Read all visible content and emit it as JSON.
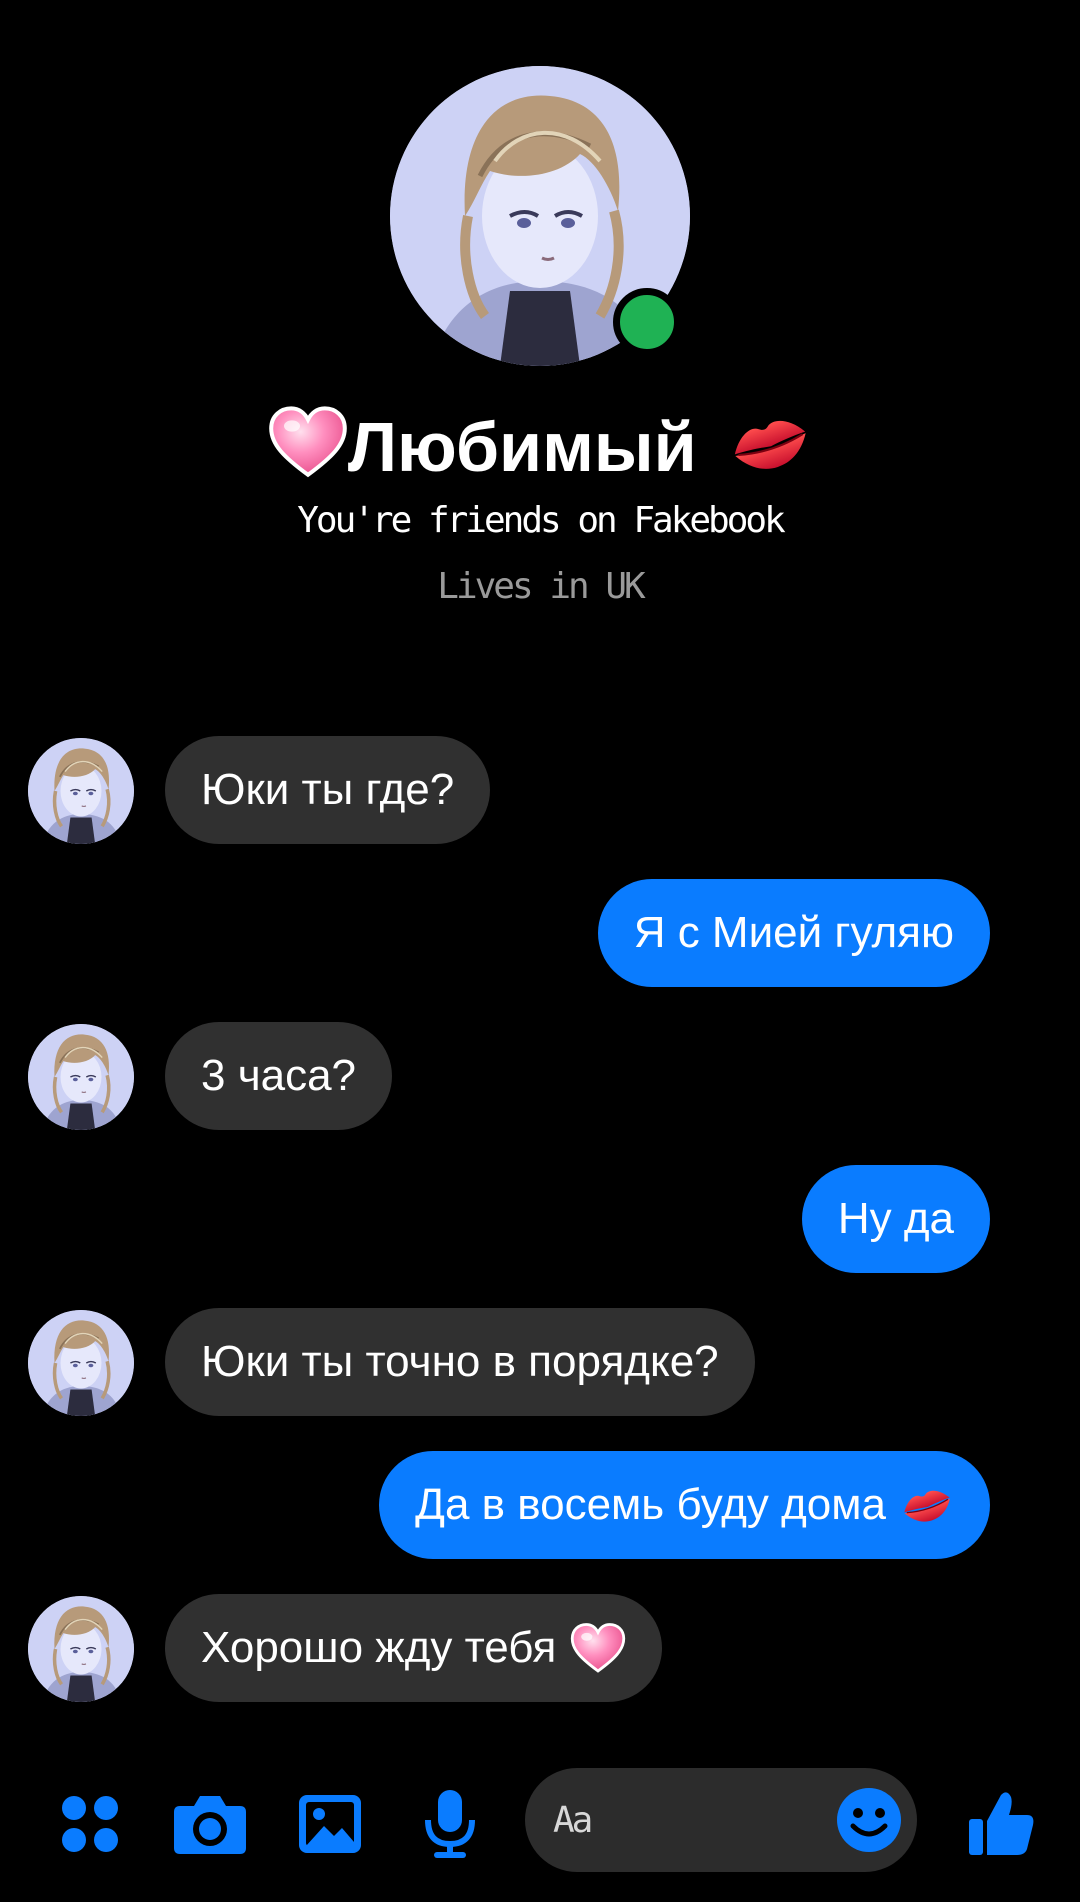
{
  "profile": {
    "name": "Любимый",
    "friends_text": "You're friends on Fakebook",
    "location_text": "Lives in UK",
    "online": true
  },
  "messages": [
    {
      "direction": "incoming",
      "text": "Юки ты где?"
    },
    {
      "direction": "outgoing",
      "text": "Я с Мией гуляю"
    },
    {
      "direction": "incoming",
      "text": "3 часа?"
    },
    {
      "direction": "outgoing",
      "text": "Ну да"
    },
    {
      "direction": "incoming",
      "text": "Юки ты точно в порядке?"
    },
    {
      "direction": "outgoing",
      "text": "Да в восемь буду дома",
      "emoji": "kiss-lips-icon"
    },
    {
      "direction": "incoming",
      "text": "Хорошо жду тебя",
      "emoji": "pink-heart-icon"
    }
  ],
  "composer": {
    "placeholder": "Aa",
    "icons": [
      "apps-icon",
      "camera-icon",
      "gallery-icon",
      "microphone-icon",
      "smiley-icon",
      "thumbs-up-icon"
    ]
  },
  "colors": {
    "background": "#000000",
    "incoming_bubble": "#303030",
    "outgoing_bubble": "#0a7cff",
    "accent": "#0a7cff",
    "online": "#1fb254"
  }
}
